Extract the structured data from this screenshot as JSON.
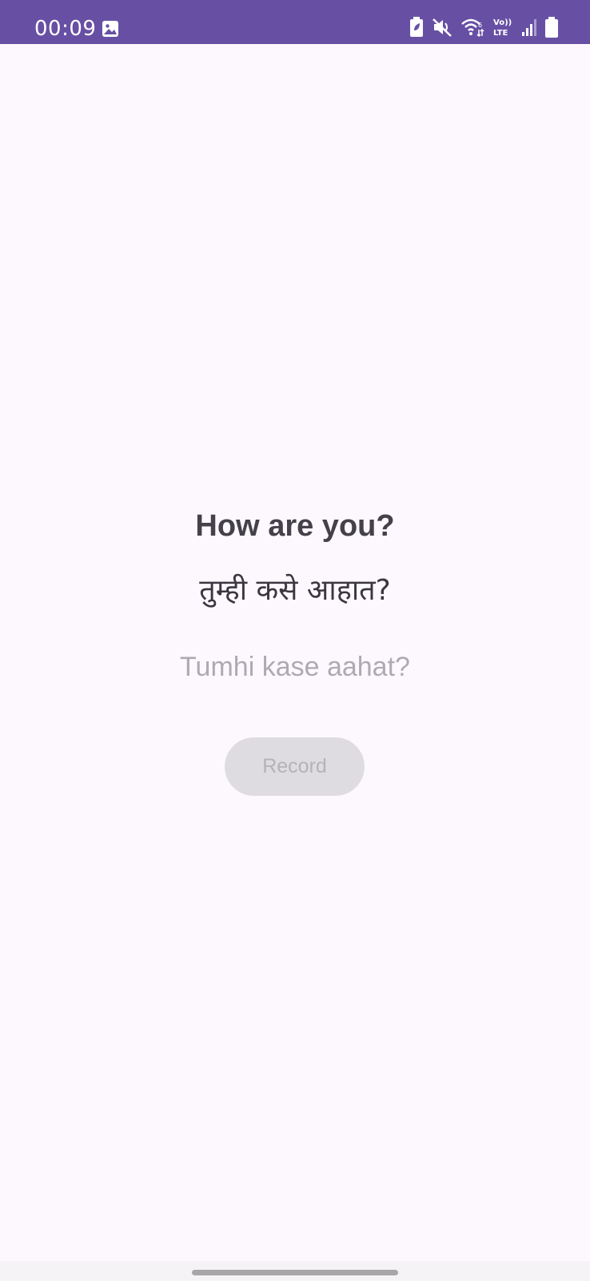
{
  "status_bar": {
    "time": "00:09",
    "left_icons": [
      "image-icon"
    ],
    "right_icons": [
      "battery-saver-icon",
      "mute-icon",
      "wifi-icon",
      "volte-icon",
      "signal-icon",
      "battery-icon"
    ],
    "volte_label_top": "Vo))",
    "volte_label_bottom": "LTE",
    "background_color": "#6750a4"
  },
  "phrase": {
    "english": "How are you?",
    "marathi": "तुम्ही कसे आहात?",
    "transliteration": "Tumhi kase aahat?"
  },
  "record_button": {
    "label": "Record",
    "state": "disabled"
  },
  "colors": {
    "background": "#fdf8fe",
    "english_text": "#44414a",
    "transliteration_text": "#adaab2",
    "button_background": "#dfdce1"
  }
}
